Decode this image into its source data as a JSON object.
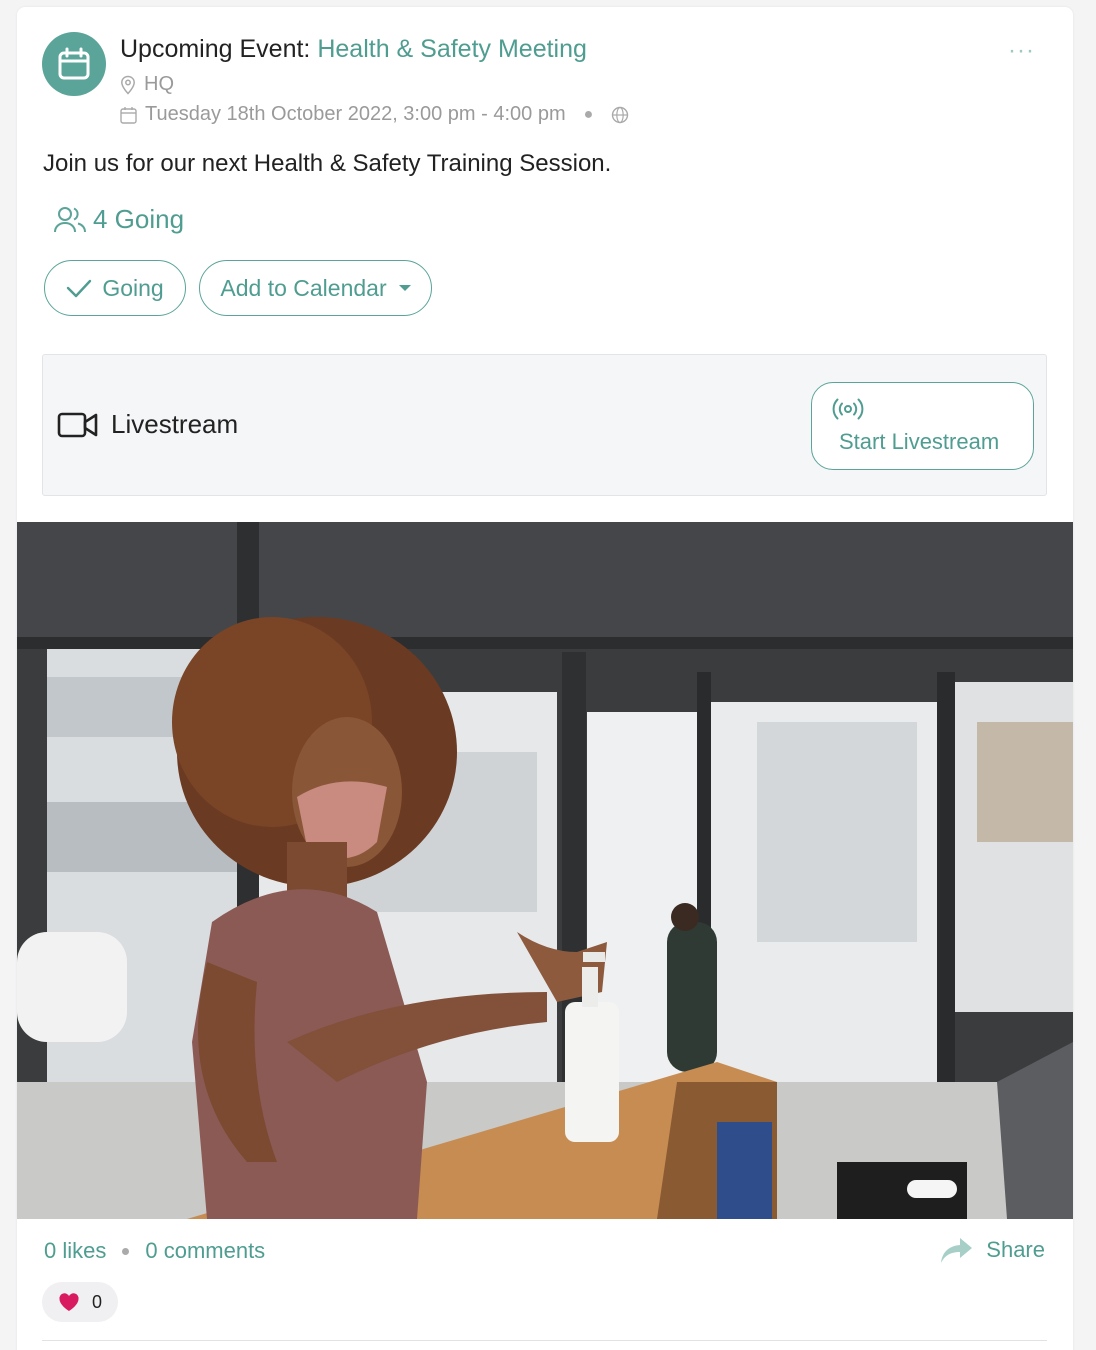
{
  "post": {
    "title_prefix": "Upcoming Event:",
    "title_link": "Health & Safety Meeting",
    "location": "HQ",
    "datetime": "Tuesday 18th October 2022, 3:00 pm - 4:00 pm",
    "description": "Join us for our next Health & Safety Training Session.",
    "going_count": "4 Going"
  },
  "actions": {
    "going_label": "Going",
    "calendar_label": "Add to Calendar"
  },
  "livestream": {
    "label": "Livestream",
    "start_label": "Start Livestream"
  },
  "footer": {
    "likes": "0 likes",
    "comments": "0 comments",
    "share": "Share",
    "reaction_count": "0"
  },
  "colors": {
    "accent": "#4f9d91",
    "avatar_bg": "#5aa499",
    "heart": "#d81b60"
  },
  "icons": [
    "calendar-icon",
    "location-pin-icon",
    "globe-icon",
    "users-icon",
    "check-icon",
    "video-camera-icon",
    "broadcast-icon",
    "share-arrow-icon",
    "heart-icon",
    "more-dots-icon"
  ]
}
